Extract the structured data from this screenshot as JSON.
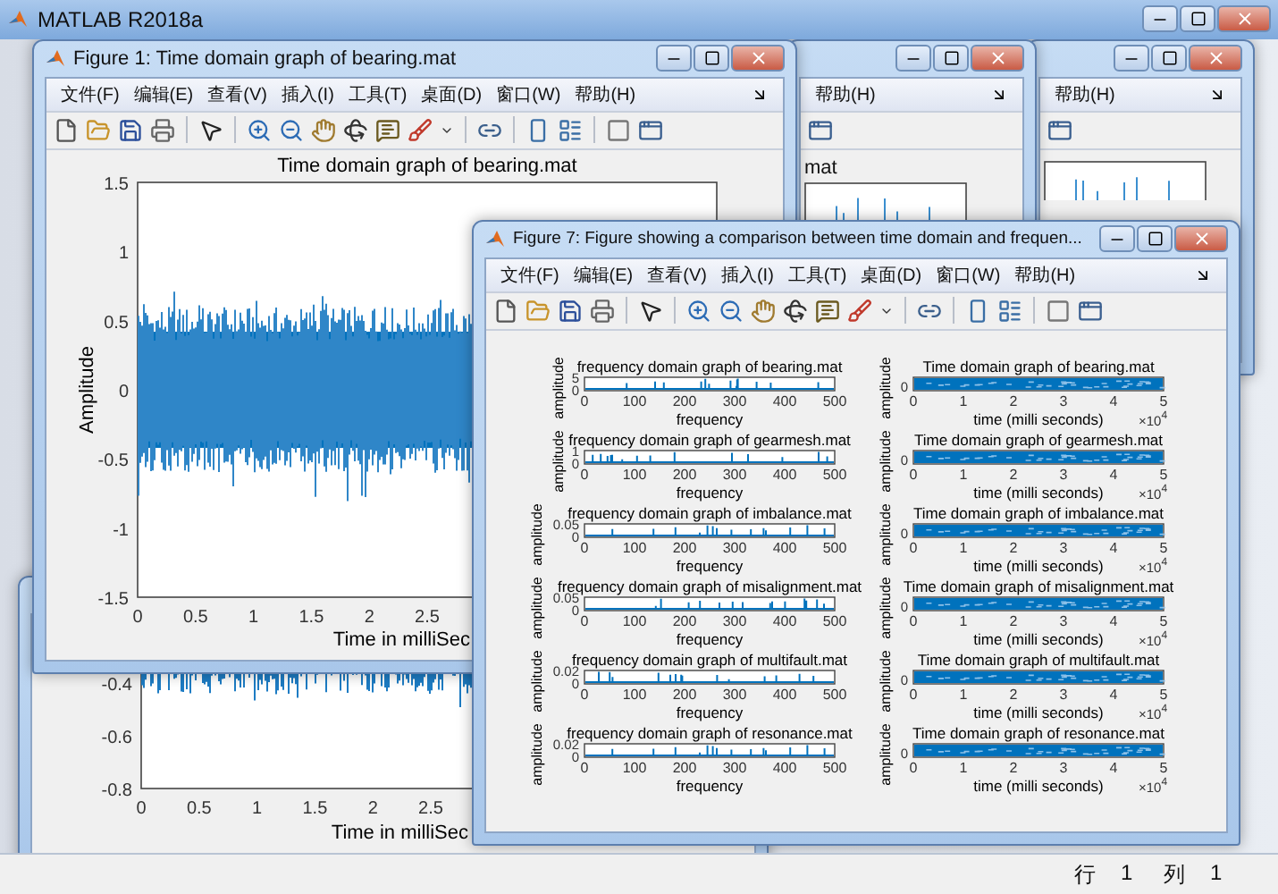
{
  "app_window": {
    "title": "MATLAB R2018a",
    "status_bar": [
      {
        "label": "行",
        "value": "1"
      },
      {
        "label": "列",
        "value": "1"
      }
    ]
  },
  "background_windows": [
    {
      "menu": [
        "帮助(H)"
      ],
      "title_fragment": "mat"
    },
    {
      "menu": [
        "帮助(H)"
      ]
    }
  ],
  "lower_window": {
    "plot": {
      "yticks": [
        "-0.4",
        "-0.6",
        "-0.8"
      ],
      "xticks": [
        "0",
        "0.5",
        "1",
        "1.5",
        "2",
        "2.5"
      ],
      "xlabel": "Time in milliSec"
    }
  },
  "figure_1": {
    "title": "Figure 1: Time domain graph of bearing.mat",
    "menu": [
      "文件(F)",
      "编辑(E)",
      "查看(V)",
      "插入(I)",
      "工具(T)",
      "桌面(D)",
      "窗口(W)",
      "帮助(H)"
    ],
    "plot": {
      "title": "Time domain graph of bearing.mat",
      "ylabel": "Amplitude",
      "xlabel": "Time in milliSec",
      "yticks": [
        "1.5",
        "1",
        "0.5",
        "0",
        "-0.5",
        "-1",
        "-1.5"
      ],
      "xticks": [
        "0",
        "0.5",
        "1",
        "1.5",
        "2",
        "2.5"
      ]
    }
  },
  "figure_7": {
    "title": "Figure 7: Figure showing a comparison between time domain and frequen...",
    "menu": [
      "文件(F)",
      "编辑(E)",
      "查看(V)",
      "插入(I)",
      "工具(T)",
      "桌面(D)",
      "窗口(W)",
      "帮助(H)"
    ],
    "subplots": [
      {
        "kind": "frequency",
        "title": "frequency domain graph of bearing.mat",
        "ylabel": "amplitude",
        "yticks": [
          "5",
          "0"
        ],
        "xticks": [
          "0",
          "100",
          "200",
          "300",
          "400",
          "500"
        ],
        "xlabel": "frequency"
      },
      {
        "kind": "time",
        "title": "Time domain graph of bearing.mat",
        "ylabel": "amplitude",
        "yticks": [
          "0"
        ],
        "xticks": [
          "0",
          "1",
          "2",
          "3",
          "4",
          "5"
        ],
        "xlabel": "time (milli seconds)",
        "x_scale": "×10",
        "x_scale_power": "4"
      },
      {
        "kind": "frequency",
        "title": "frequency domain graph of gearmesh.mat",
        "ylabel": "amplitude",
        "yticks": [
          "1",
          "0"
        ],
        "xticks": [
          "0",
          "100",
          "200",
          "300",
          "400",
          "500"
        ],
        "xlabel": "frequency"
      },
      {
        "kind": "time",
        "title": "Time domain graph of gearmesh.mat",
        "ylabel": "amplitude",
        "yticks": [
          "0"
        ],
        "xticks": [
          "0",
          "1",
          "2",
          "3",
          "4",
          "5"
        ],
        "xlabel": "time (milli seconds)",
        "x_scale": "×10",
        "x_scale_power": "4"
      },
      {
        "kind": "frequency",
        "title": "frequency domain graph of imbalance.mat",
        "ylabel": "amplitude",
        "yticks": [
          "0.05",
          "0"
        ],
        "xticks": [
          "0",
          "100",
          "200",
          "300",
          "400",
          "500"
        ],
        "xlabel": "frequency"
      },
      {
        "kind": "time",
        "title": "Time domain graph of imbalance.mat",
        "ylabel": "amplitude",
        "yticks": [
          "0"
        ],
        "xticks": [
          "0",
          "1",
          "2",
          "3",
          "4",
          "5"
        ],
        "xlabel": "time (milli seconds)",
        "x_scale": "×10",
        "x_scale_power": "4"
      },
      {
        "kind": "frequency",
        "title": "frequency domain graph of misalignment.mat",
        "ylabel": "amplitude",
        "yticks": [
          "0.05",
          "0"
        ],
        "xticks": [
          "0",
          "100",
          "200",
          "300",
          "400",
          "500"
        ],
        "xlabel": "frequency"
      },
      {
        "kind": "time",
        "title": "Time domain graph of misalignment.mat",
        "ylabel": "amplitude",
        "yticks": [
          "0"
        ],
        "xticks": [
          "0",
          "1",
          "2",
          "3",
          "4",
          "5"
        ],
        "xlabel": "time (milli seconds)",
        "x_scale": "×10",
        "x_scale_power": "4"
      },
      {
        "kind": "frequency",
        "title": "frequency domain graph of multifault.mat",
        "ylabel": "amplitude",
        "yticks": [
          "0.02",
          "0"
        ],
        "xticks": [
          "0",
          "100",
          "200",
          "300",
          "400",
          "500"
        ],
        "xlabel": "frequency"
      },
      {
        "kind": "time",
        "title": "Time domain graph of multifault.mat",
        "ylabel": "amplitude",
        "yticks": [
          "0"
        ],
        "xticks": [
          "0",
          "1",
          "2",
          "3",
          "4",
          "5"
        ],
        "xlabel": "time (milli seconds)",
        "x_scale": "×10",
        "x_scale_power": "4"
      },
      {
        "kind": "frequency",
        "title": "frequency domain graph of resonance.mat",
        "ylabel": "amplitude",
        "yticks": [
          "0.02",
          "0"
        ],
        "xticks": [
          "0",
          "100",
          "200",
          "300",
          "400",
          "500"
        ],
        "xlabel": "frequency"
      },
      {
        "kind": "time",
        "title": "Time domain graph of resonance.mat",
        "ylabel": "amplitude",
        "yticks": [
          "0"
        ],
        "xticks": [
          "0",
          "1",
          "2",
          "3",
          "4",
          "5"
        ],
        "xlabel": "time (milli seconds)",
        "x_scale": "×10",
        "x_scale_power": "4"
      }
    ]
  }
}
